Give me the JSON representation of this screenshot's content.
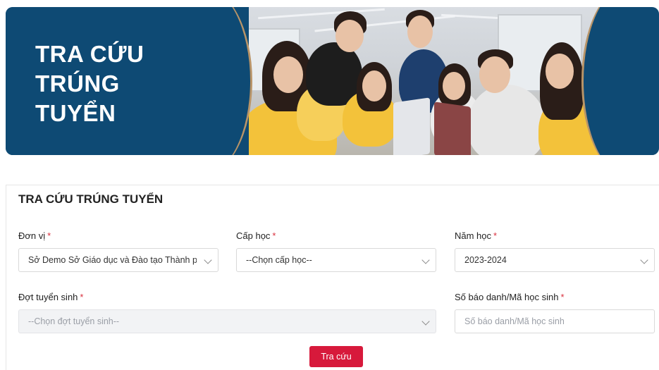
{
  "banner": {
    "title_lines": [
      "TRA CỨU",
      "TRÚNG",
      "TUYỂN"
    ]
  },
  "form": {
    "title": "TRA CỨU TRÚNG TUYỂN",
    "required_mark": "*",
    "fields": {
      "don_vi": {
        "label": "Đơn vị",
        "value": "Sở Demo Sở Giáo dục và Đào tạo Thành phố Đ"
      },
      "cap_hoc": {
        "label": "Cấp học",
        "value": "--Chọn cấp học--"
      },
      "nam_hoc": {
        "label": "Năm học",
        "value": "2023-2024"
      },
      "dot_tuyen_sinh": {
        "label": "Đợt tuyển sinh",
        "value": "--Chọn đợt tuyển sinh--"
      },
      "so_bao_danh": {
        "label": "Số báo danh/Mã học sinh",
        "placeholder": "Số báo danh/Mã học sinh"
      }
    },
    "submit_label": "Tra cứu"
  },
  "colors": {
    "banner_blue": "#0e4a74",
    "accent_gold": "#b89468",
    "button_red": "#d7193b",
    "required_red": "#d9303e"
  }
}
